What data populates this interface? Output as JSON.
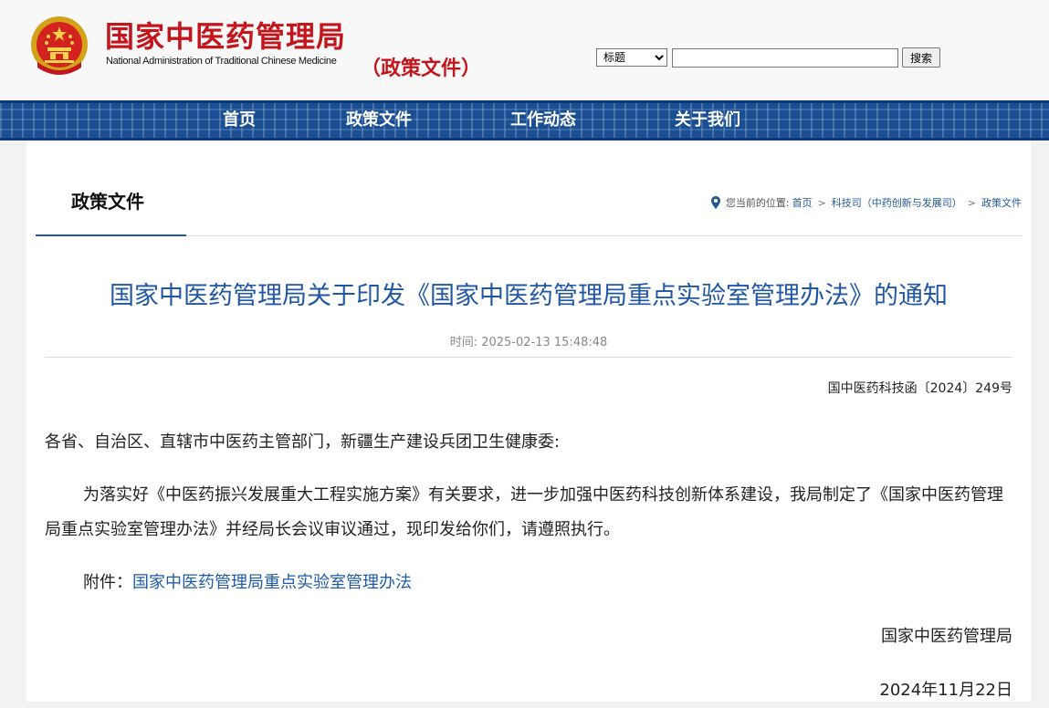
{
  "header": {
    "brand_cn": "国家中医药管理局",
    "brand_en": "National Administration of Traditional Chinese Medicine",
    "subtitle": "（政策文件）",
    "search": {
      "select_value": "标题",
      "input_value": "",
      "button_label": "搜索"
    },
    "colors": {
      "brand_red": "#c3161c",
      "nav_blue": "#1a4f93"
    }
  },
  "nav": {
    "items": [
      {
        "label": "首页"
      },
      {
        "label": "政策文件"
      },
      {
        "label": "工作动态"
      },
      {
        "label": "关于我们"
      }
    ]
  },
  "section": {
    "title": "政策文件",
    "breadcrumb": {
      "prefix": "您当前的位置:",
      "items": [
        "首页",
        "科技司（中药创新与发展司）",
        "政策文件"
      ],
      "separator": ">"
    }
  },
  "article": {
    "title": "国家中医药管理局关于印发《国家中医药管理局重点实验室管理办法》的通知",
    "time_label": "时间:",
    "time_value": "2025-02-13 15:48:48",
    "doc_number": "国中医药科技函〔2024〕249号",
    "addressee": "各省、自治区、直辖市中医药主管部门，新疆生产建设兵团卫生健康委:",
    "body": "为落实好《中医药振兴发展重大工程实施方案》有关要求，进一步加强中医药科技创新体系建设，我局制定了《国家中医药管理局重点实验室管理办法》并经局长会议审议通过，现印发给你们，请遵照执行。",
    "attachment_label": "附件：",
    "attachment_link": "国家中医药管理局重点实验室管理办法",
    "signature": "国家中医药管理局",
    "date": "2024年11月22日"
  }
}
